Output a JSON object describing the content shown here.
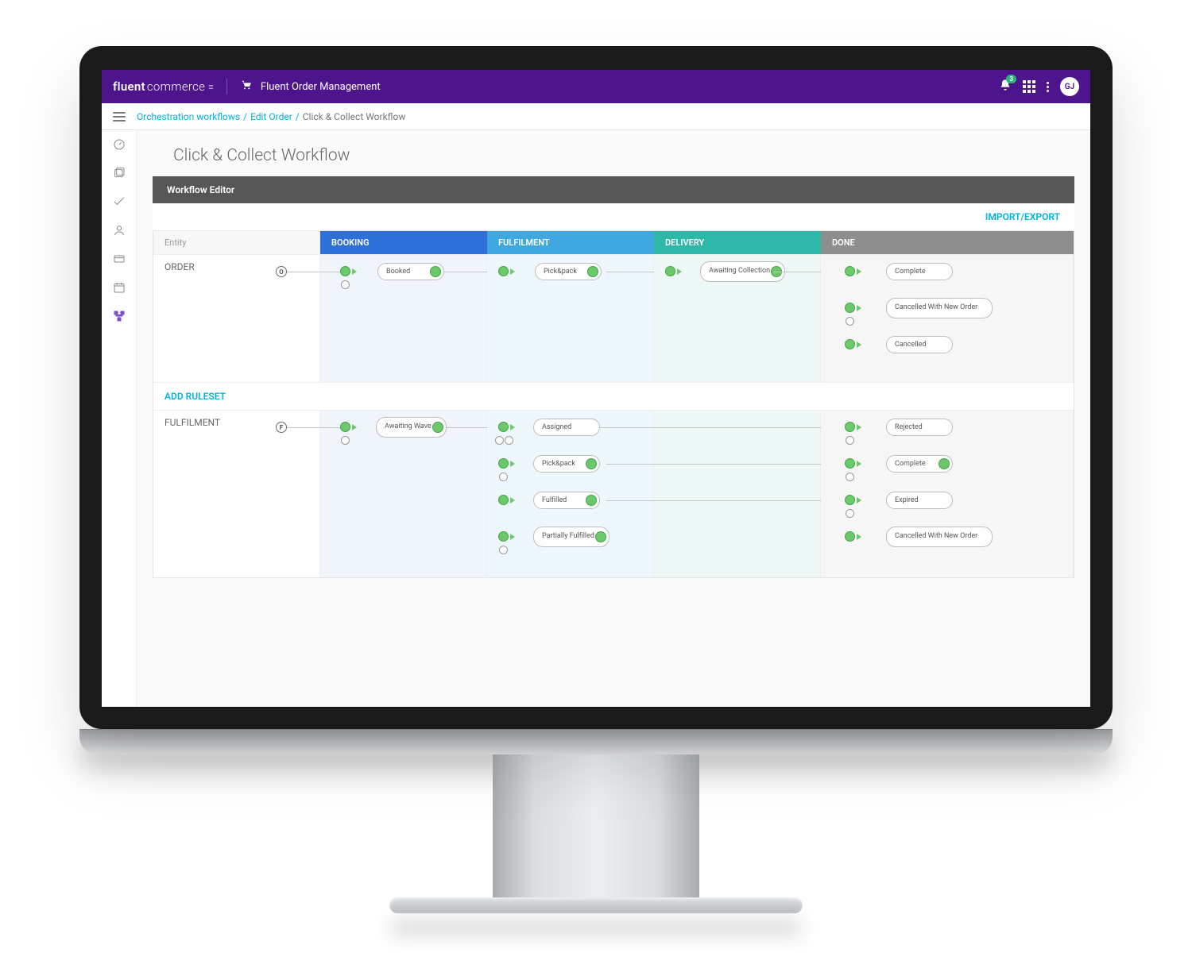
{
  "brand": {
    "name": "fluent",
    "suffix": "commerce"
  },
  "topbar": {
    "title": "Fluent Order Management",
    "badge_count": "3",
    "avatar_initials": "GJ"
  },
  "breadcrumb": {
    "item0": "Orchestration workflows",
    "item1": "Edit Order",
    "current": "Click & Collect Workflow"
  },
  "page": {
    "title": "Click & Collect Workflow"
  },
  "editor": {
    "header": "Workflow Editor",
    "import_export": "IMPORT/EXPORT",
    "add_ruleset": "ADD RULESET"
  },
  "columns": {
    "entity": "Entity",
    "booking": "BOOKING",
    "fulfilment": "FULFILMENT",
    "delivery": "DELIVERY",
    "done": "DONE"
  },
  "lanes": {
    "order": {
      "label": "ORDER",
      "entity_marker": "O",
      "booking": {
        "node0": "Booked"
      },
      "fulfilment": {
        "node0": "Pick&pack"
      },
      "delivery": {
        "node0": "Awaiting Collection"
      },
      "done": {
        "node0": "Complete",
        "node1": "Cancelled With New Order",
        "node2": "Cancelled"
      }
    },
    "fulfilment": {
      "label": "FULFILMENT",
      "entity_marker": "F",
      "booking": {
        "node0": "Awaiting Wave"
      },
      "fulfilment": {
        "node0": "Assigned",
        "node1": "Pick&pack",
        "node2": "Fulfilled",
        "node3": "Partially Fulfilled"
      },
      "done": {
        "node0": "Rejected",
        "node1": "Complete",
        "node2": "Expired",
        "node3": "Cancelled With New Order"
      }
    }
  }
}
